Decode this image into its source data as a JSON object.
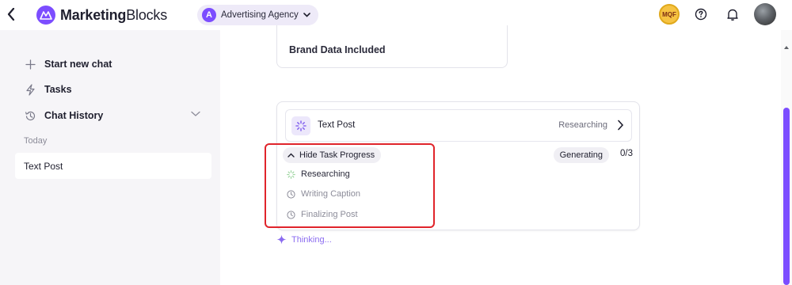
{
  "header": {
    "brand_bold": "Marketing",
    "brand_light": "Blocks",
    "workspace": {
      "initial": "A",
      "label": "Advertising Agency"
    },
    "badge_text": "MQF"
  },
  "sidebar": {
    "items": [
      {
        "label": "Start new chat",
        "icon": "plus-icon"
      },
      {
        "label": "Tasks",
        "icon": "lightning-icon"
      },
      {
        "label": "Chat History",
        "icon": "history-icon"
      }
    ],
    "section_label": "Today",
    "chats": [
      {
        "label": "Text Post"
      }
    ]
  },
  "main": {
    "brand_card_label": "Brand Data Included",
    "task": {
      "title": "Text Post",
      "status": "Researching",
      "toggle_label": "Hide Task Progress",
      "generating_label": "Generating",
      "progress_count": "0/3",
      "steps": [
        {
          "label": "Researching",
          "state": "active"
        },
        {
          "label": "Writing Caption",
          "state": "pending"
        },
        {
          "label": "Finalizing Post",
          "state": "pending"
        }
      ]
    },
    "thinking_label": "Thinking..."
  },
  "colors": {
    "accent": "#7c4dff",
    "highlight": "#e0242b",
    "sidebar_bg": "#f6f5f8"
  }
}
